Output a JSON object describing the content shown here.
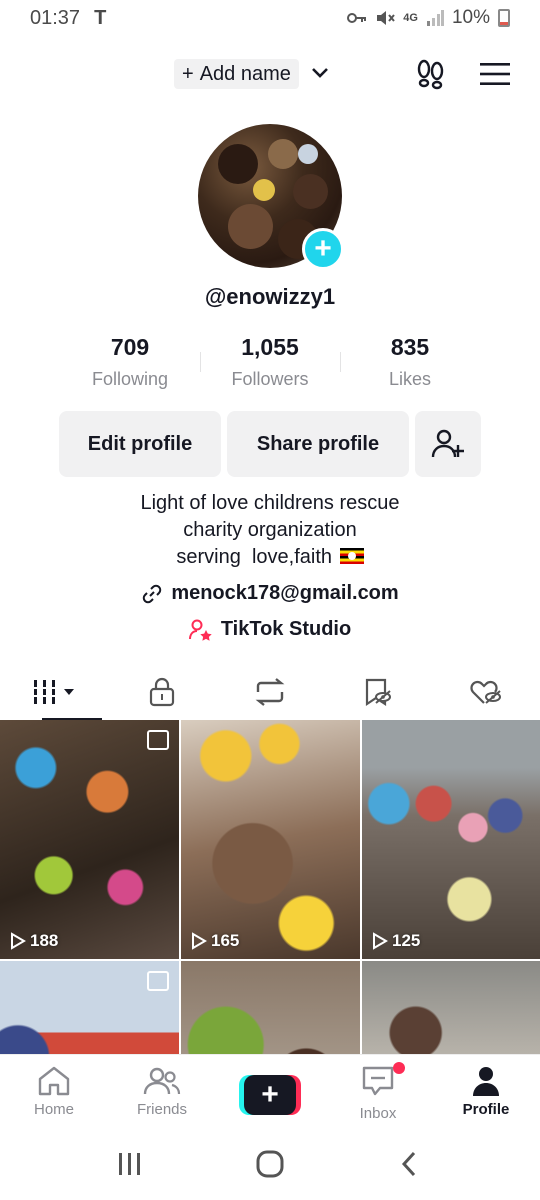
{
  "status_bar": {
    "time": "01:37",
    "carrier_icon": "T",
    "network": "4G",
    "battery": "10%"
  },
  "header": {
    "add_name_label": "Add name",
    "add_name_prefix": "+"
  },
  "profile": {
    "username": "@enowizzy1",
    "stats": [
      {
        "value": "709",
        "label": "Following"
      },
      {
        "value": "1,055",
        "label": "Followers"
      },
      {
        "value": "835",
        "label": "Likes"
      }
    ],
    "buttons": {
      "edit": "Edit profile",
      "share": "Share profile"
    },
    "bio_lines": [
      "Light of love childrens rescue",
      "charity organization",
      "serving  love,faith"
    ],
    "email": "menock178@gmail.com",
    "studio_label": "TikTok Studio"
  },
  "tabs": [
    "videos-grid-icon",
    "lock-icon",
    "repost-icon",
    "favorites-icon",
    "liked-icon"
  ],
  "videos": [
    {
      "views": "188",
      "type": "photo"
    },
    {
      "views": "165",
      "type": "video"
    },
    {
      "views": "125",
      "type": "video"
    },
    {
      "views": "",
      "type": "photo"
    },
    {
      "views": "",
      "type": "video"
    },
    {
      "views": "",
      "type": "video"
    }
  ],
  "bottom_nav": {
    "home": "Home",
    "friends": "Friends",
    "inbox": "Inbox",
    "profile": "Profile"
  },
  "colors": {
    "accent_cyan": "#20d5ec",
    "accent_pink": "#fe2c55",
    "text_primary": "#161823",
    "text_secondary": "#8a8b91",
    "button_bg": "#f1f1f2"
  }
}
